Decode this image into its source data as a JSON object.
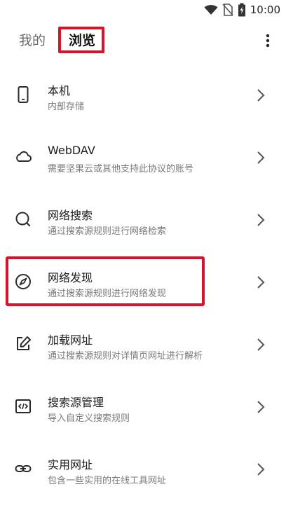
{
  "status_bar": {
    "time": "10:00",
    "icons": [
      "wifi-icon",
      "no-sim-icon",
      "battery-charging-icon"
    ]
  },
  "header": {
    "tabs": [
      {
        "label": "我的",
        "selected": false
      },
      {
        "label": "浏览",
        "selected": true
      }
    ],
    "menu_icon": "more-vert-icon"
  },
  "items": [
    {
      "title": "本机",
      "subtitle": "内部存储",
      "icon": "phone-icon"
    },
    {
      "title": "WebDAV",
      "subtitle": "需要坚果云或其他支持此协议的账号",
      "icon": "cloud-icon"
    },
    {
      "title": "网络搜索",
      "subtitle": "通过搜索源规则进行网络检索",
      "icon": "search-icon"
    },
    {
      "title": "网络发现",
      "subtitle": "通过搜索源规则进行网络发现",
      "icon": "compass-icon"
    },
    {
      "title": "加载网址",
      "subtitle": "通过搜索源规则对详情页网址进行解析",
      "icon": "edit-icon"
    },
    {
      "title": "搜索源管理",
      "subtitle": "导入自定义搜索规则",
      "icon": "code-icon"
    },
    {
      "title": "实用网址",
      "subtitle": "包含一些实用的在线工具网址",
      "icon": "link-icon"
    }
  ],
  "colors": {
    "highlight": "#d6132b",
    "text_primary": "#1c1c1c",
    "text_secondary": "#7a7a7a"
  }
}
